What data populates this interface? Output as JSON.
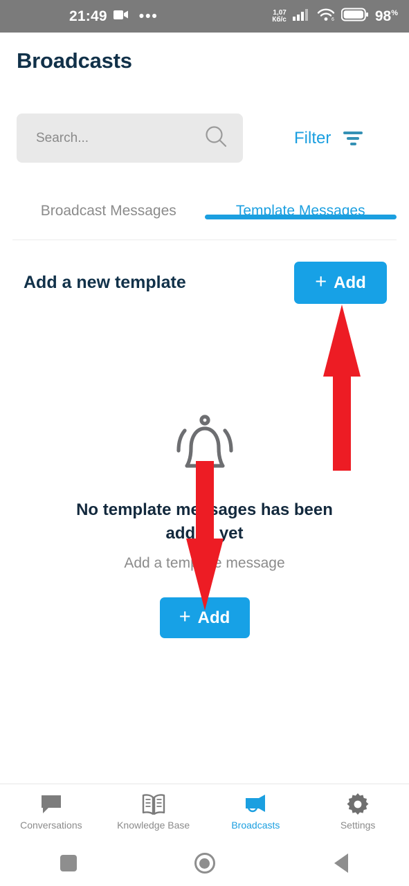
{
  "status_bar": {
    "time": "21:49",
    "video_icon": "video-camera-icon",
    "overflow_dots": "•••",
    "network_speed_value": "1,07",
    "network_speed_unit": "Кб/c",
    "signal_icon": "cellular-signal-icon",
    "wifi_icon": "wifi-icon",
    "wifi_badge": "6",
    "battery_icon": "battery-icon",
    "battery_percent": "98",
    "battery_percent_symbol": "%",
    "background_color": "#7b7b7b"
  },
  "header": {
    "title": "Broadcasts",
    "title_color": "#113149"
  },
  "search": {
    "placeholder": "Search...",
    "value": "",
    "icon": "search-icon",
    "filter_label": "Filter",
    "filter_icon": "filter-icon",
    "accent_color": "#1b9fe0"
  },
  "tabs": [
    {
      "label": "Broadcast Messages",
      "active": false
    },
    {
      "label": "Template Messages",
      "active": true
    }
  ],
  "add_new_section": {
    "title": "Add a new template",
    "button_label": "Add",
    "button_plus": "+",
    "button_color": "#17a1e6"
  },
  "empty_state": {
    "illustration": "bell-icon",
    "title": "No template messages has been added yet",
    "subtitle": "Add a template message",
    "button_label": "Add",
    "button_plus": "+"
  },
  "annotations": {
    "arrow_color": "#ed1c24",
    "arrows": [
      {
        "name": "arrow-pointing-to-top-add-button",
        "direction": "up"
      },
      {
        "name": "arrow-pointing-to-bottom-add-button",
        "direction": "down"
      }
    ]
  },
  "bottom_nav": [
    {
      "label": "Conversations",
      "icon": "chat-bubble-icon",
      "active": false
    },
    {
      "label": "Knowledge Base",
      "icon": "book-icon",
      "active": false
    },
    {
      "label": "Broadcasts",
      "icon": "megaphone-icon",
      "active": true
    },
    {
      "label": "Settings",
      "icon": "gear-icon",
      "active": false
    }
  ],
  "system_bar": {
    "recents": "square-recents-icon",
    "home": "circle-home-icon",
    "back": "triangle-back-icon"
  }
}
